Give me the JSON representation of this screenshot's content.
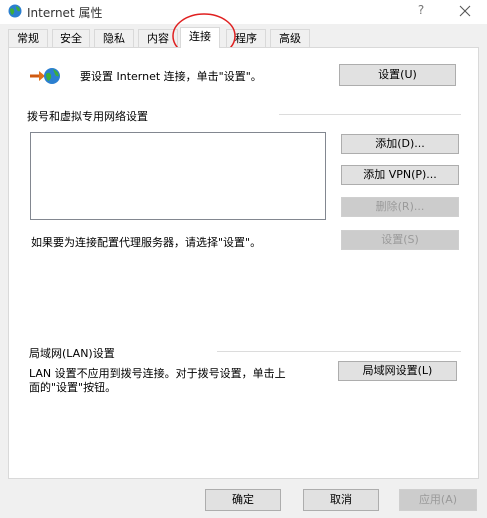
{
  "window": {
    "title": "Internet 属性",
    "help_label": "?"
  },
  "tabs": [
    {
      "label": "常规"
    },
    {
      "label": "安全"
    },
    {
      "label": "隐私"
    },
    {
      "label": "内容"
    },
    {
      "label": "连接"
    },
    {
      "label": "程序"
    },
    {
      "label": "高级"
    }
  ],
  "active_tab": "连接",
  "connection": {
    "setup_text": "要设置 Internet 连接，单击\"设置\"。",
    "setup_button": "设置(U)"
  },
  "dialup": {
    "section_label": "拨号和虚拟专用网络设置",
    "add_button": "添加(D)...",
    "add_vpn_button": "添加 VPN(P)...",
    "delete_button": "删除(R)...",
    "proxy_text": "如果要为连接配置代理服务器，请选择\"设置\"。",
    "settings_button": "设置(S)"
  },
  "lan": {
    "section_label": "局域网(LAN)设置",
    "description_line1": "LAN 设置不应用到拨号连接。对于拨号设置，单击上",
    "description_line2": "面的\"设置\"按钮。",
    "lan_settings_button": "局域网设置(L)"
  },
  "footer": {
    "ok_button": "确定",
    "cancel_button": "取消",
    "apply_button": "应用(A)"
  },
  "colors": {
    "annotation_circle": "#e02020",
    "button_face": "#e1e1e1",
    "disabled_button": "#cccccc"
  }
}
